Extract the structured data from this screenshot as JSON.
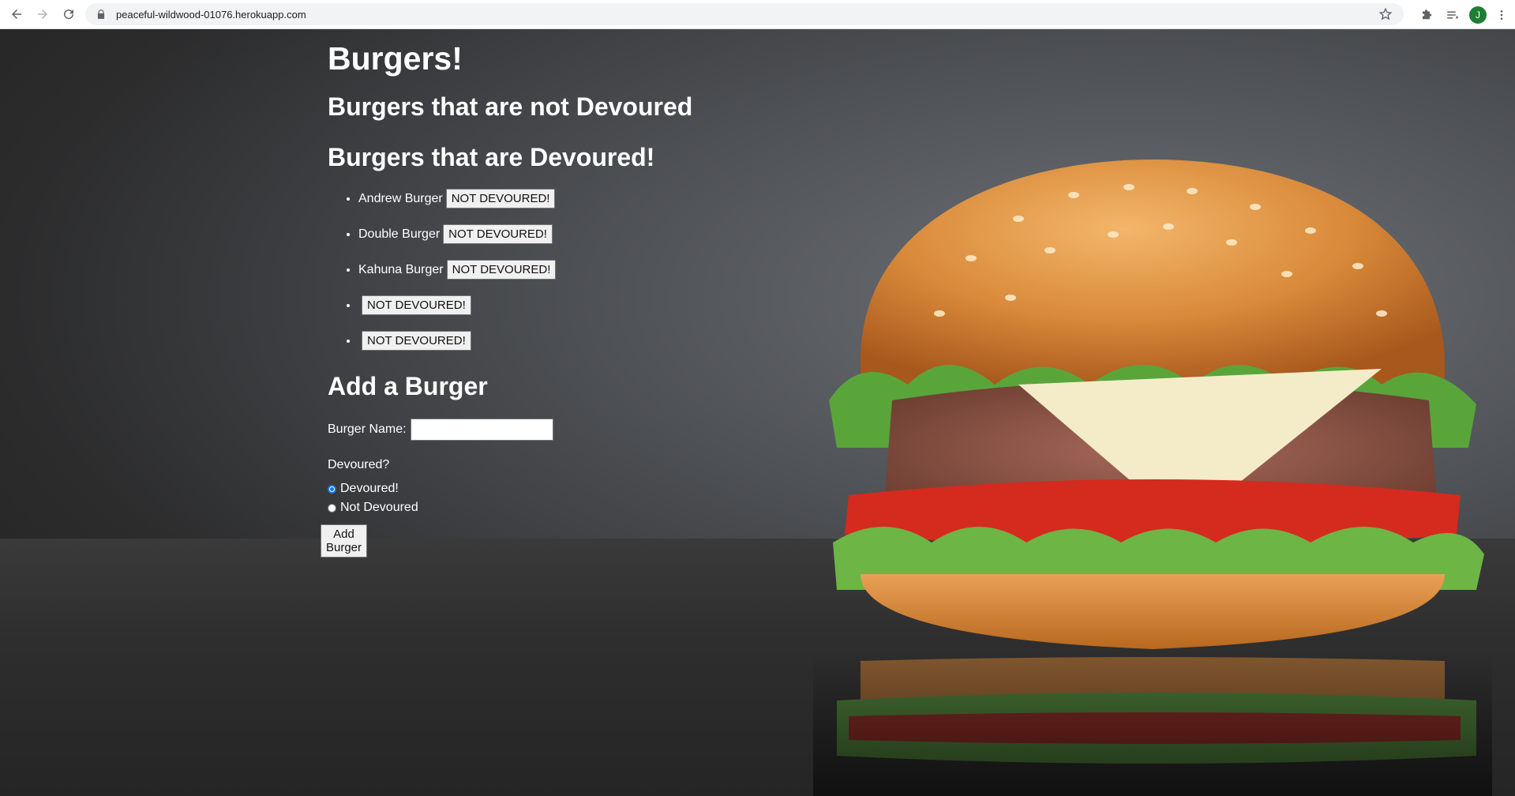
{
  "browser": {
    "url": "peaceful-wildwood-01076.herokuapp.com",
    "avatar_letter": "J"
  },
  "page": {
    "title": "Burgers!",
    "not_devoured_heading": "Burgers that are not Devoured",
    "devoured_heading": "Burgers that are Devoured!",
    "devoured_list": [
      {
        "name": "Andrew Burger",
        "button": "NOT DEVOURED!"
      },
      {
        "name": "Double Burger",
        "button": "NOT DEVOURED!"
      },
      {
        "name": "Kahuna Burger",
        "button": "NOT DEVOURED!"
      },
      {
        "name": "",
        "button": "NOT DEVOURED!"
      },
      {
        "name": "",
        "button": "NOT DEVOURED!"
      }
    ],
    "add_heading": "Add a Burger",
    "form": {
      "name_label": "Burger Name:",
      "name_value": "",
      "devoured_label": "Devoured?",
      "option_devoured": "Devoured!",
      "option_not_devoured": "Not Devoured",
      "selected": "Devoured!",
      "submit_label": "Add Burger"
    }
  },
  "colors": {
    "text": "#ffffff",
    "radio_accent": "#1a73e8"
  }
}
